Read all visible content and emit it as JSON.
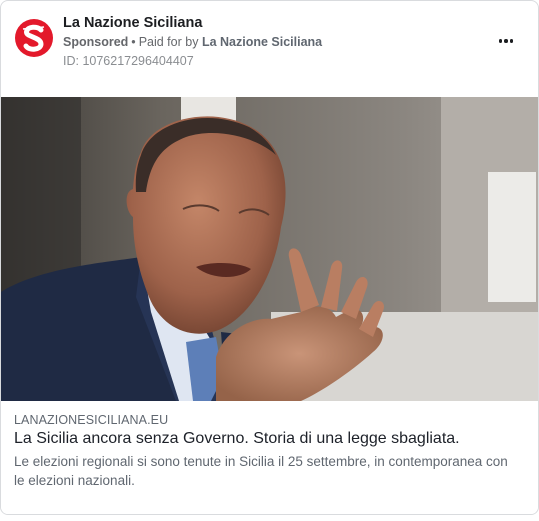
{
  "post": {
    "page_name": "La Nazione Siciliana",
    "sponsored": "Sponsored",
    "separator": "•",
    "paid_for_prefix": "Paid for by",
    "paid_for_name": "La Nazione Siciliana",
    "ad_id": "ID: 1076217296404407",
    "more_icon": "more-horizontal-icon",
    "logo_icon": "la-nazione-siciliana-logo",
    "logo_color": "#e3192b"
  },
  "link": {
    "domain": "LANAZIONESICILIANA.EU",
    "headline": "La Sicilia ancora senza Governo. Storia di una legge sbagliata.",
    "description": "Le elezioni regionali si sono tenute in Sicilia il 25 settembre, in contemporanea con le elezioni nazionali."
  }
}
